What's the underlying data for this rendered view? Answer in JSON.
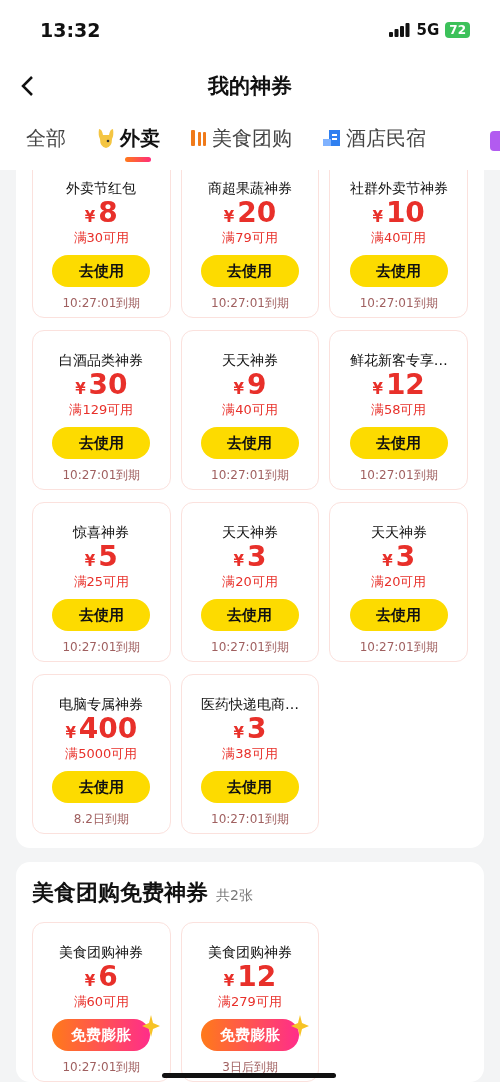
{
  "status_bar": {
    "time": "13:32",
    "network": "5G",
    "battery": "72"
  },
  "nav": {
    "title": "我的神券"
  },
  "tabs": [
    {
      "label": "全部",
      "kind": "plain",
      "selected": false
    },
    {
      "label": "外卖",
      "kind": "rabbit",
      "selected": true
    },
    {
      "label": "美食团购",
      "kind": "fork",
      "selected": false
    },
    {
      "label": "酒店民宿",
      "kind": "hotel",
      "selected": false
    }
  ],
  "sections": [
    {
      "coupons": [
        {
          "name": "外卖节红包",
          "currency": "¥",
          "amount": "8",
          "condition": "满30可用",
          "button": "去使用",
          "kind": "use",
          "expiry": "10:27:01到期"
        },
        {
          "name": "商超果蔬神券",
          "currency": "¥",
          "amount": "20",
          "condition": "满79可用",
          "button": "去使用",
          "kind": "use",
          "expiry": "10:27:01到期"
        },
        {
          "name": "社群外卖节神券",
          "currency": "¥",
          "amount": "10",
          "condition": "满40可用",
          "button": "去使用",
          "kind": "use",
          "expiry": "10:27:01到期"
        },
        {
          "name": "白酒品类神券",
          "currency": "¥",
          "amount": "30",
          "condition": "满129可用",
          "button": "去使用",
          "kind": "use",
          "expiry": "10:27:01到期"
        },
        {
          "name": "天天神券",
          "currency": "¥",
          "amount": "9",
          "condition": "满40可用",
          "button": "去使用",
          "kind": "use",
          "expiry": "10:27:01到期"
        },
        {
          "name": "鲜花新客专享…",
          "currency": "¥",
          "amount": "12",
          "condition": "满58可用",
          "button": "去使用",
          "kind": "use",
          "expiry": "10:27:01到期"
        },
        {
          "name": "惊喜神券",
          "currency": "¥",
          "amount": "5",
          "condition": "满25可用",
          "button": "去使用",
          "kind": "use",
          "expiry": "10:27:01到期"
        },
        {
          "name": "天天神券",
          "currency": "¥",
          "amount": "3",
          "condition": "满20可用",
          "button": "去使用",
          "kind": "use",
          "expiry": "10:27:01到期"
        },
        {
          "name": "天天神券",
          "currency": "¥",
          "amount": "3",
          "condition": "满20可用",
          "button": "去使用",
          "kind": "use",
          "expiry": "10:27:01到期"
        },
        {
          "name": "电脑专属神券",
          "currency": "¥",
          "amount": "400",
          "condition": "满5000可用",
          "button": "去使用",
          "kind": "use",
          "expiry": "8.2日到期"
        },
        {
          "name": "医药快递电商…",
          "currency": "¥",
          "amount": "3",
          "condition": "满38可用",
          "button": "去使用",
          "kind": "use",
          "expiry": "10:27:01到期"
        }
      ]
    },
    {
      "title": "美食团购免费神券",
      "count": "共2张",
      "coupons": [
        {
          "name": "美食团购神券",
          "currency": "¥",
          "amount": "6",
          "condition": "满60可用",
          "button": "免费膨胀",
          "kind": "inflate",
          "expiry": "10:27:01到期"
        },
        {
          "name": "美食团购神券",
          "currency": "¥",
          "amount": "12",
          "condition": "满279可用",
          "button": "免费膨胀",
          "kind": "inflate",
          "expiry": "3日后到期"
        }
      ]
    }
  ]
}
